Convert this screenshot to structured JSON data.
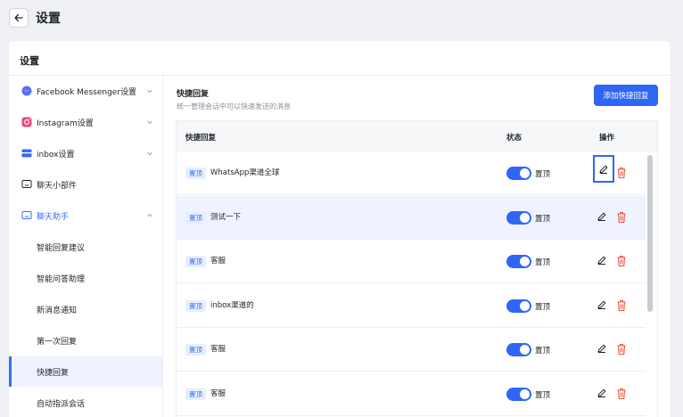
{
  "header": {
    "title": "设置"
  },
  "card": {
    "title": "设置"
  },
  "sidebar": {
    "items": [
      {
        "label": "Facebook Messenger设置",
        "icon": "messenger-icon"
      },
      {
        "label": "Instagram设置",
        "icon": "instagram-icon"
      },
      {
        "label": "inbox设置",
        "icon": "inbox-icon"
      },
      {
        "label": "聊天小部件",
        "icon": "chat-widget-icon"
      },
      {
        "label": "聊天助手",
        "icon": "chat-assistant-icon"
      }
    ],
    "sub_items": [
      {
        "label": "智能回复建议"
      },
      {
        "label": "智能问答助理"
      },
      {
        "label": "新消息通知"
      },
      {
        "label": "第一次回复"
      },
      {
        "label": "快捷回复"
      },
      {
        "label": "自动指派会话"
      }
    ]
  },
  "main": {
    "title": "快捷回复",
    "description": "统一管理会话中可以快速发送的消息",
    "add_button": "添加快捷回复"
  },
  "table": {
    "headers": [
      "快捷回复",
      "状态",
      "操作"
    ],
    "rows": [
      {
        "tag": "置顶",
        "name": "WhatsApp渠道全球",
        "status": "置顶"
      },
      {
        "tag": "置顶",
        "name": "测试一下",
        "status": "置顶"
      },
      {
        "tag": "置顶",
        "name": "客服",
        "status": "置顶"
      },
      {
        "tag": "置顶",
        "name": "inbox渠道的",
        "status": "置顶"
      },
      {
        "tag": "置顶",
        "name": "客服",
        "status": "置顶"
      },
      {
        "tag": "置顶",
        "name": "客服",
        "status": "置顶"
      }
    ]
  },
  "colors": {
    "accent": "#2f66f6",
    "danger": "#f0533a",
    "selected_bg": "#eef3ff"
  }
}
